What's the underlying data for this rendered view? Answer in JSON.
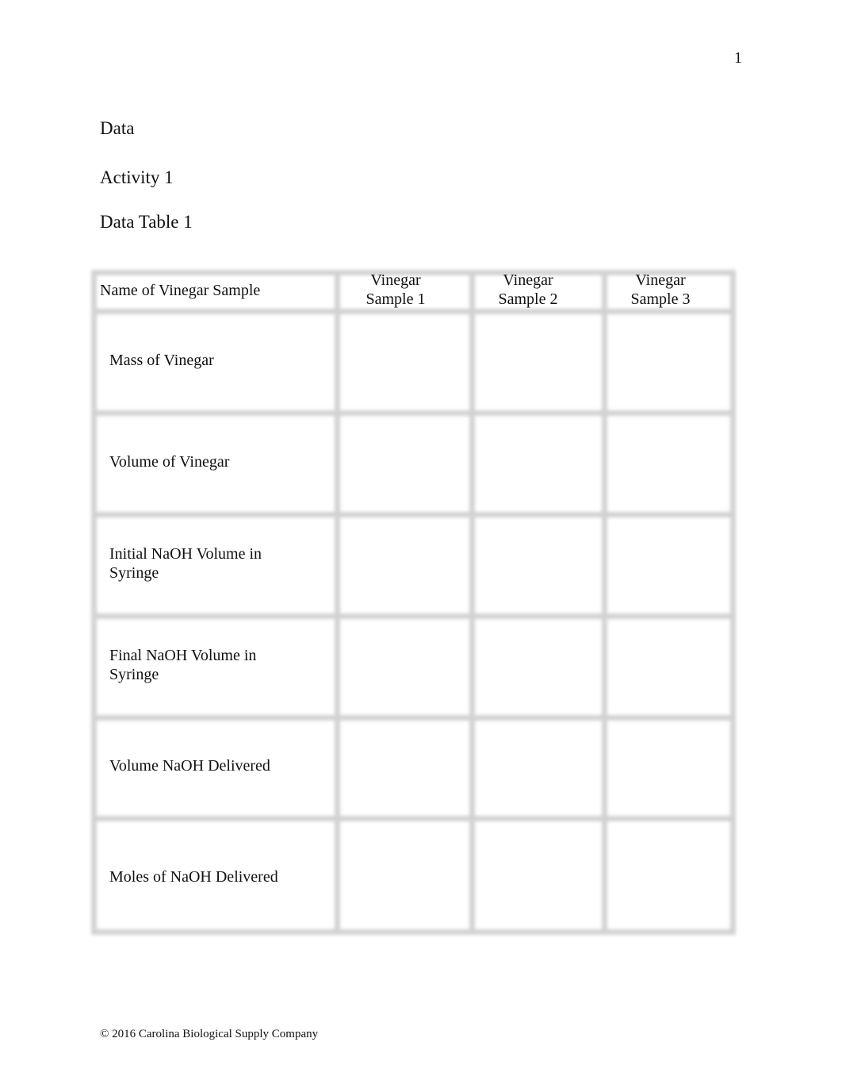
{
  "page_number": "1",
  "headings": {
    "section": "Data",
    "activity": "Activity 1",
    "table_title": "Data Table 1"
  },
  "table": {
    "header_label": "Name of Vinegar Sample",
    "columns": [
      {
        "line1": "Vinegar",
        "line2": "Sample 1"
      },
      {
        "line1": "Vinegar",
        "line2": "Sample 2"
      },
      {
        "line1": "Vinegar",
        "line2": "Sample 3"
      }
    ],
    "rows": [
      {
        "label": "Mass of Vinegar",
        "values": [
          "",
          "",
          ""
        ]
      },
      {
        "label": "Volume of Vinegar",
        "values": [
          "",
          "",
          ""
        ]
      },
      {
        "label": "Initial NaOH Volume in Syringe",
        "values": [
          "",
          "",
          ""
        ]
      },
      {
        "label": "Final NaOH Volume in Syringe",
        "values": [
          "",
          "",
          ""
        ]
      },
      {
        "label": "Volume NaOH Delivered",
        "values": [
          "",
          "",
          ""
        ]
      },
      {
        "label": "Moles of NaOH Delivered",
        "values": [
          "",
          "",
          ""
        ]
      }
    ]
  },
  "footer": "© 2016 Carolina Biological Supply Company"
}
